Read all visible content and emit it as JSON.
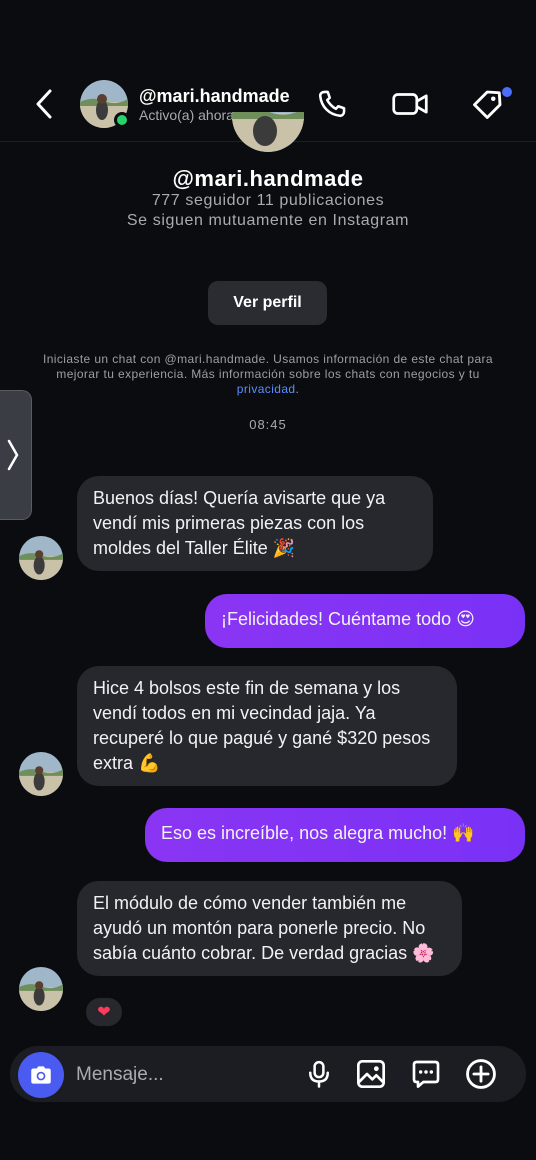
{
  "header": {
    "username": "@mari.handmade",
    "status": "Activo(a) ahora",
    "icons": [
      "back-arrow-icon",
      "phone-icon",
      "video-icon",
      "tag-icon"
    ]
  },
  "profile": {
    "username": "@mari.handmade",
    "stats": "777 seguidor 11 publicaciones",
    "mutual": "Se siguen mutuamente en Instagram",
    "view_profile_label": "Ver perfil"
  },
  "disclaimer": {
    "line1": "Iniciaste un chat con @mari.handmade. Usamos información de este chat para",
    "line2": "mejorar tu experiencia. Más información sobre los chats con negocios y tu",
    "link": "privacidad",
    "end": "."
  },
  "timestamp": "08:45",
  "messages": [
    {
      "direction": "in",
      "text": "Buenos días! Quería avisarte que ya vendí mis primeras piezas con los moldes del Taller Élite",
      "emoji": "🎉"
    },
    {
      "direction": "out",
      "text": "¡Felicidades! Cuéntame todo",
      "emoji": "😍"
    },
    {
      "direction": "in",
      "text": "Hice 4 bolsos este fin de semana y los vendí todos en mi vecindad jaja. Ya recuperé lo que pagué y gané $320 pesos extra",
      "emoji": "💪"
    },
    {
      "direction": "out",
      "text": "Eso es increíble, nos alegra mucho!",
      "emoji": "🙌"
    },
    {
      "direction": "in",
      "text": "El módulo de cómo vender también me ayudó un montón para ponerle precio. No sabía cuánto cobrar. De verdad gracias",
      "emoji": "🌸"
    }
  ],
  "reaction": "❤",
  "composer": {
    "placeholder": "Mensaje...",
    "icons": [
      "camera-icon",
      "microphone-icon",
      "gallery-icon",
      "sticker-icon",
      "plus-icon"
    ]
  },
  "colors": {
    "background": "#0b0c0f",
    "incoming_bubble": "#26282e",
    "outgoing_bubble": "#8a35f3",
    "online": "#2bd26b",
    "link": "#5b8cff",
    "camera_button": "#4a5bf2"
  }
}
